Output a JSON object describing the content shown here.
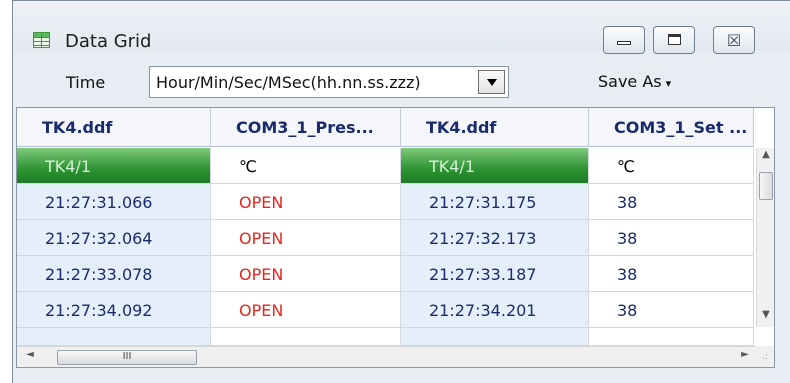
{
  "window": {
    "title": "Data Grid"
  },
  "titlebar": {
    "minimize_icon": "minimize-icon",
    "maximize_icon": "maximize-icon",
    "close_icon": "close-icon",
    "close_glyph": "☒"
  },
  "toolbar": {
    "time_label": "Time",
    "time_format_value": "Hour/Min/Sec/MSec(hh.nn.ss.zzz)",
    "save_as_label": "Save As",
    "save_as_caret": "▾"
  },
  "grid": {
    "columns": [
      "TK4.ddf",
      "COM3_1_Pres...",
      "TK4.ddf",
      "COM3_1_Set ..."
    ],
    "subheader": [
      "TK4/1",
      "℃",
      "TK4/1",
      "℃"
    ],
    "rows": [
      [
        "21:27:31.066",
        "OPEN",
        "21:27:31.175",
        "38"
      ],
      [
        "21:27:32.064",
        "OPEN",
        "21:27:32.173",
        "38"
      ],
      [
        "21:27:33.078",
        "OPEN",
        "21:27:33.187",
        "38"
      ],
      [
        "21:27:34.092",
        "OPEN",
        "21:27:34.201",
        "38"
      ]
    ]
  },
  "scrollbars": {
    "up_glyph": "▲",
    "down_glyph": "▼",
    "left_glyph": "◄",
    "right_glyph": "►",
    "hthumb_grip": "III",
    "grip_glyph": ".:"
  },
  "colors": {
    "accent_green": "#2e9433",
    "open_red": "#e8251c",
    "header_text": "#1a2b6b",
    "time_cell_bg": "#e5effa"
  }
}
